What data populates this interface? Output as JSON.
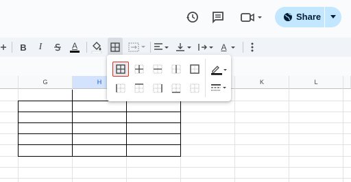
{
  "header": {
    "share_label": "Share",
    "icons": [
      "history-icon",
      "comment-icon",
      "meet-icon",
      "globe-icon",
      "chevron-down-icon"
    ]
  },
  "toolbar": {
    "items": [
      "plus-icon",
      "bold-icon",
      "italic-icon",
      "strikethrough-icon",
      "text-color-icon",
      "fill-color-icon",
      "borders-icon",
      "merge-cells-icon",
      "horizontal-align-icon",
      "vertical-align-icon",
      "text-wrap-icon",
      "text-rotation-icon",
      "more-icon"
    ],
    "bold_label": "B",
    "italic_label": "I",
    "text_color_label": "A",
    "rotation_label": "A"
  },
  "columns": {
    "headers": [
      "G",
      "H",
      "K",
      "L"
    ],
    "selected": "H"
  },
  "borders_menu": {
    "options_row1": [
      "all-borders",
      "inner-borders",
      "horizontal-borders",
      "vertical-borders",
      "outer-borders"
    ],
    "options_row2": [
      "left-border",
      "top-border",
      "right-border",
      "bottom-border",
      "clear-borders"
    ],
    "selected": "all-borders",
    "border_color": "#000000",
    "tools": [
      "border-color-icon",
      "border-style-icon"
    ]
  }
}
